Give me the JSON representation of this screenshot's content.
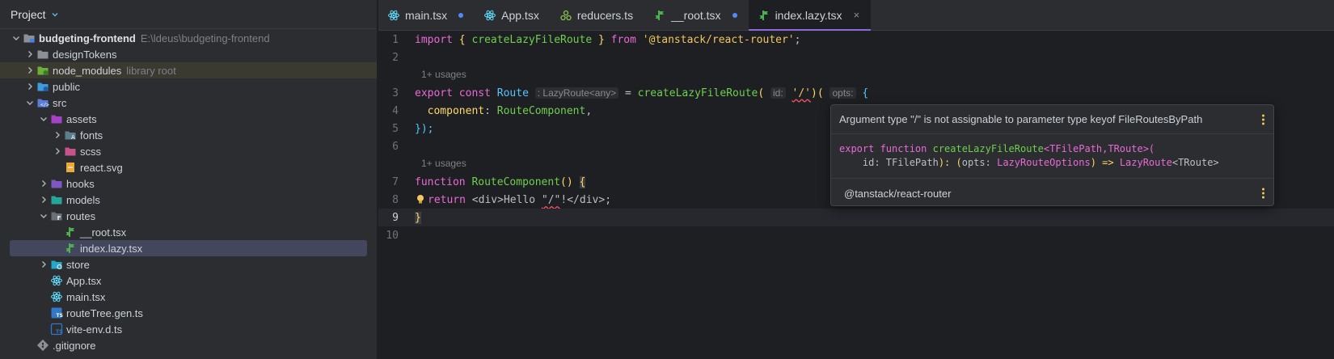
{
  "project": {
    "title": "Project",
    "tree": [
      {
        "name": "budgeting-frontend",
        "hint": "E:\\ldeus\\budgeting-frontend",
        "depth": 0,
        "arrow": "down",
        "icon": "folder-module-icon",
        "bold": true
      },
      {
        "name": "designTokens",
        "depth": 1,
        "arrow": "right",
        "icon": "folder-icon"
      },
      {
        "name": "node_modules",
        "lib": "library root",
        "depth": 1,
        "arrow": "right",
        "icon": "folder-node-modules-icon",
        "highlight": true
      },
      {
        "name": "public",
        "depth": 1,
        "arrow": "right",
        "icon": "folder-public-icon"
      },
      {
        "name": "src",
        "depth": 1,
        "arrow": "down",
        "icon": "folder-src-icon"
      },
      {
        "name": "assets",
        "depth": 2,
        "arrow": "down",
        "icon": "folder-assets-icon"
      },
      {
        "name": "fonts",
        "depth": 3,
        "arrow": "right",
        "icon": "folder-fonts-icon"
      },
      {
        "name": "scss",
        "depth": 3,
        "arrow": "right",
        "icon": "folder-scss-icon"
      },
      {
        "name": "react.svg",
        "depth": 3,
        "arrow": "none",
        "icon": "svg-file-icon"
      },
      {
        "name": "hooks",
        "depth": 2,
        "arrow": "right",
        "icon": "folder-hooks-icon"
      },
      {
        "name": "models",
        "depth": 2,
        "arrow": "right",
        "icon": "folder-models-icon"
      },
      {
        "name": "routes",
        "depth": 2,
        "arrow": "down",
        "icon": "folder-routes-icon"
      },
      {
        "name": "__root.tsx",
        "depth": 3,
        "arrow": "none",
        "icon": "route-file-icon"
      },
      {
        "name": "index.lazy.tsx",
        "depth": 3,
        "arrow": "none",
        "icon": "route-file-icon",
        "selected": true
      },
      {
        "name": "store",
        "depth": 2,
        "arrow": "right",
        "icon": "folder-store-icon"
      },
      {
        "name": "App.tsx",
        "depth": 2,
        "arrow": "none",
        "icon": "react-file-icon"
      },
      {
        "name": "main.tsx",
        "depth": 2,
        "arrow": "none",
        "icon": "react-file-icon"
      },
      {
        "name": "routeTree.gen.ts",
        "depth": 2,
        "arrow": "none",
        "icon": "ts-file-icon"
      },
      {
        "name": "vite-env.d.ts",
        "depth": 2,
        "arrow": "none",
        "icon": "ts-def-file-icon"
      },
      {
        "name": ".gitignore",
        "depth": 1,
        "arrow": "none",
        "icon": "git-file-icon"
      }
    ]
  },
  "tabs": [
    {
      "label": "main.tsx",
      "icon": "react-file-icon",
      "modified": true
    },
    {
      "label": "App.tsx",
      "icon": "react-file-icon",
      "modified": false
    },
    {
      "label": "reducers.ts",
      "icon": "redux-file-icon",
      "modified": false
    },
    {
      "label": "__root.tsx",
      "icon": "route-file-icon",
      "modified": true
    },
    {
      "label": "index.lazy.tsx",
      "icon": "route-file-icon",
      "active": true,
      "close": "×"
    }
  ],
  "editor": {
    "line_numbers": [
      "1",
      "2",
      "3",
      "4",
      "5",
      "6",
      "7",
      "8",
      "9",
      "10"
    ],
    "usages_label": "1+ usages",
    "line1": {
      "kw_import": "import",
      "b_open": "{",
      "fn": "createLazyFileRoute",
      "b_close": "}",
      "kw_from": "from",
      "str": "'@tanstack/react-router'",
      "semi": ";"
    },
    "line3": {
      "kw_export": "export",
      "kw_const": "const",
      "ident": "Route",
      "type_hint": ": LazyRoute<any>",
      "eq": " = ",
      "fn": "createLazyFileRoute",
      "paren": "(",
      "id_hint": "id:",
      "str": "'/'",
      "mid": ")(",
      "opts_hint": "opts:",
      "brace": "{"
    },
    "line4": {
      "prop": "component",
      "colon": ": ",
      "value": "RouteComponent",
      "comma": ","
    },
    "line5": {
      "text": "});"
    },
    "line7": {
      "kw": "function",
      "name": "RouteComponent",
      "parens": "()",
      "brace": "{"
    },
    "line8": {
      "kw": "return",
      "open_tag": "<div>",
      "text_a": "Hello ",
      "str": "\"/\"",
      "text_b": "!",
      "close_tag": "</div>",
      "semi": ";"
    },
    "line9": {
      "text": "}"
    }
  },
  "tooltip": {
    "message": "Argument type \"/\" is not assignable to parameter type keyof FileRoutesByPath",
    "sig_line1_kw": "export function",
    "sig_line1_fn": "createLazyFileRoute",
    "sig_line1_gen": "<TFilePath,TRoute>(",
    "sig_line2_a": "    id: TFilePath",
    "sig_line2_b": "): (",
    "sig_line2_c": "opts",
    "sig_line2_d": ": ",
    "sig_line2_e": "LazyRouteOptions",
    "sig_line2_f": ") => ",
    "sig_line2_g": "LazyRoute",
    "sig_line2_h": "<TRoute>",
    "source": "@tanstack/react-router"
  }
}
